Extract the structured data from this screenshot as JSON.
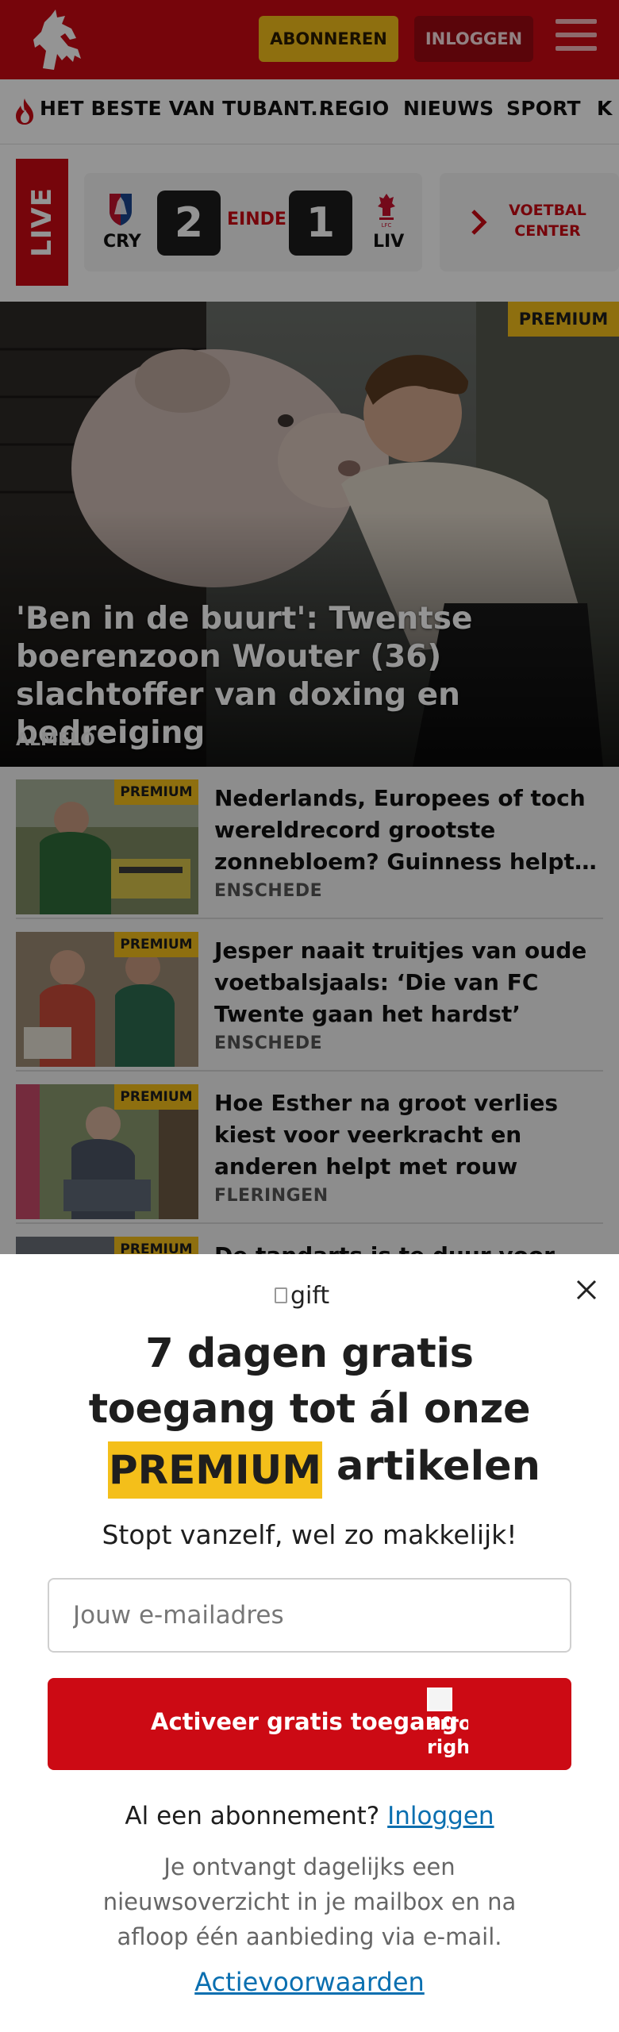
{
  "header": {
    "logo_icon": "tubantia-horse-logo",
    "subscribe_label": "ABONNEREN",
    "login_label": "INLOGGEN",
    "menu_icon": "hamburger-icon",
    "colors": {
      "brand_red": "#cc0a14",
      "premium_yellow": "#f4bf1a"
    }
  },
  "nav": {
    "items": [
      {
        "label": "HET BESTE VAN TUBANT...",
        "icon": "flame-icon"
      },
      {
        "label": "REGIO"
      },
      {
        "label": "NIEUWS"
      },
      {
        "label": "SPORT"
      },
      {
        "label": "K"
      }
    ]
  },
  "live": {
    "tag": "LIVE",
    "home": {
      "code": "CRY",
      "score": "2",
      "icon": "crystal-palace-crest"
    },
    "status": "EINDE",
    "away": {
      "code": "LIV",
      "score": "1",
      "icon": "liverpool-crest"
    },
    "voetbal_center": "VOETBAL CENTER",
    "chevron_icon": "chevron-right-icon"
  },
  "hero": {
    "badge": "PREMIUM",
    "title": "'Ben in de buurt': Twentse boerenzoon Wouter (36) slachtoffer van doxing en bedreiging",
    "location": "ALMELO"
  },
  "articles": [
    {
      "badge": "PREMIUM",
      "title": "Nederlands, Europees of toch wereldrecord grootste zonnebloem? Guinness helpt…",
      "location": "ENSCHEDE"
    },
    {
      "badge": "PREMIUM",
      "title": "Jesper naait truitjes van oude voetbalsjaals: ‘Die van FC Twente gaan het hardst’",
      "location": "ENSCHEDE"
    },
    {
      "badge": "PREMIUM",
      "title": "Hoe Esther na groot verlies kiest voor veerkracht en anderen helpt met rouw",
      "location": "FLERINGEN"
    },
    {
      "badge": "PREMIUM",
      "title": "De tandarts is te duur voor Diana",
      "location": ""
    }
  ],
  "modal": {
    "gift_alt": "gift",
    "title_line1": "7 dagen gratis",
    "title_line2": "toegang tot ál onze",
    "premium_word": "PREMIUM",
    "title_line3_rest": "artikelen",
    "subtitle": "Stopt vanzelf, wel zo makkelijk!",
    "email_placeholder": "Jouw e-mailadres",
    "email_value": "",
    "cta_label": "Activeer gratis toegang",
    "cta_arrow_alt": "arrow right",
    "have_subscription": "Al een abonnement?",
    "login_link": "Inloggen",
    "info": "Je ontvangt dagelijks een nieuwsoverzicht in je mailbox en na afloop één aanbieding via e-mail.",
    "terms_link": "Actievoorwaarden",
    "close_icon": "close-icon"
  }
}
